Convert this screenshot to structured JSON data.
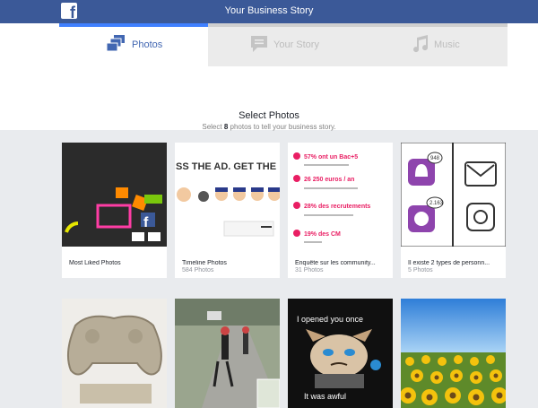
{
  "header": {
    "title": "Your Business Story",
    "logo_letter": "f"
  },
  "tabs": [
    {
      "label": "Photos",
      "icon": "photos-icon",
      "active": true
    },
    {
      "label": "Your Story",
      "icon": "story-icon",
      "active": false
    },
    {
      "label": "Music",
      "icon": "music-icon",
      "active": false
    }
  ],
  "select": {
    "title": "Select Photos",
    "prefix": "Select ",
    "count": "8",
    "suffix": " photos to tell your business story."
  },
  "albums": [
    {
      "name": "Most Liked Photos",
      "count": ""
    },
    {
      "name": "Timeline Photos",
      "count": "584 Photos",
      "image_text": "SS THE AD. GET THE"
    },
    {
      "name": "Enquête sur les community...",
      "count": "31 Photos",
      "image_text": [
        "57% ont un Bac+5",
        "26 250 euros / an",
        "28% des recrutements",
        "19% des CM"
      ]
    },
    {
      "name": "Il existe 2 types de personn...",
      "count": "5 Photos",
      "image_text": [
        "948",
        "2.163"
      ]
    }
  ],
  "photos_row2": [
    {
      "name": "gamepad-sand-photo"
    },
    {
      "name": "street-view-photo"
    },
    {
      "name": "grumpy-cat-photo",
      "image_text": [
        "I opened you once",
        "It was awful"
      ]
    },
    {
      "name": "sunflowers-photo"
    }
  ],
  "colors": {
    "brand": "#3b5998",
    "accent": "#4080ff"
  }
}
